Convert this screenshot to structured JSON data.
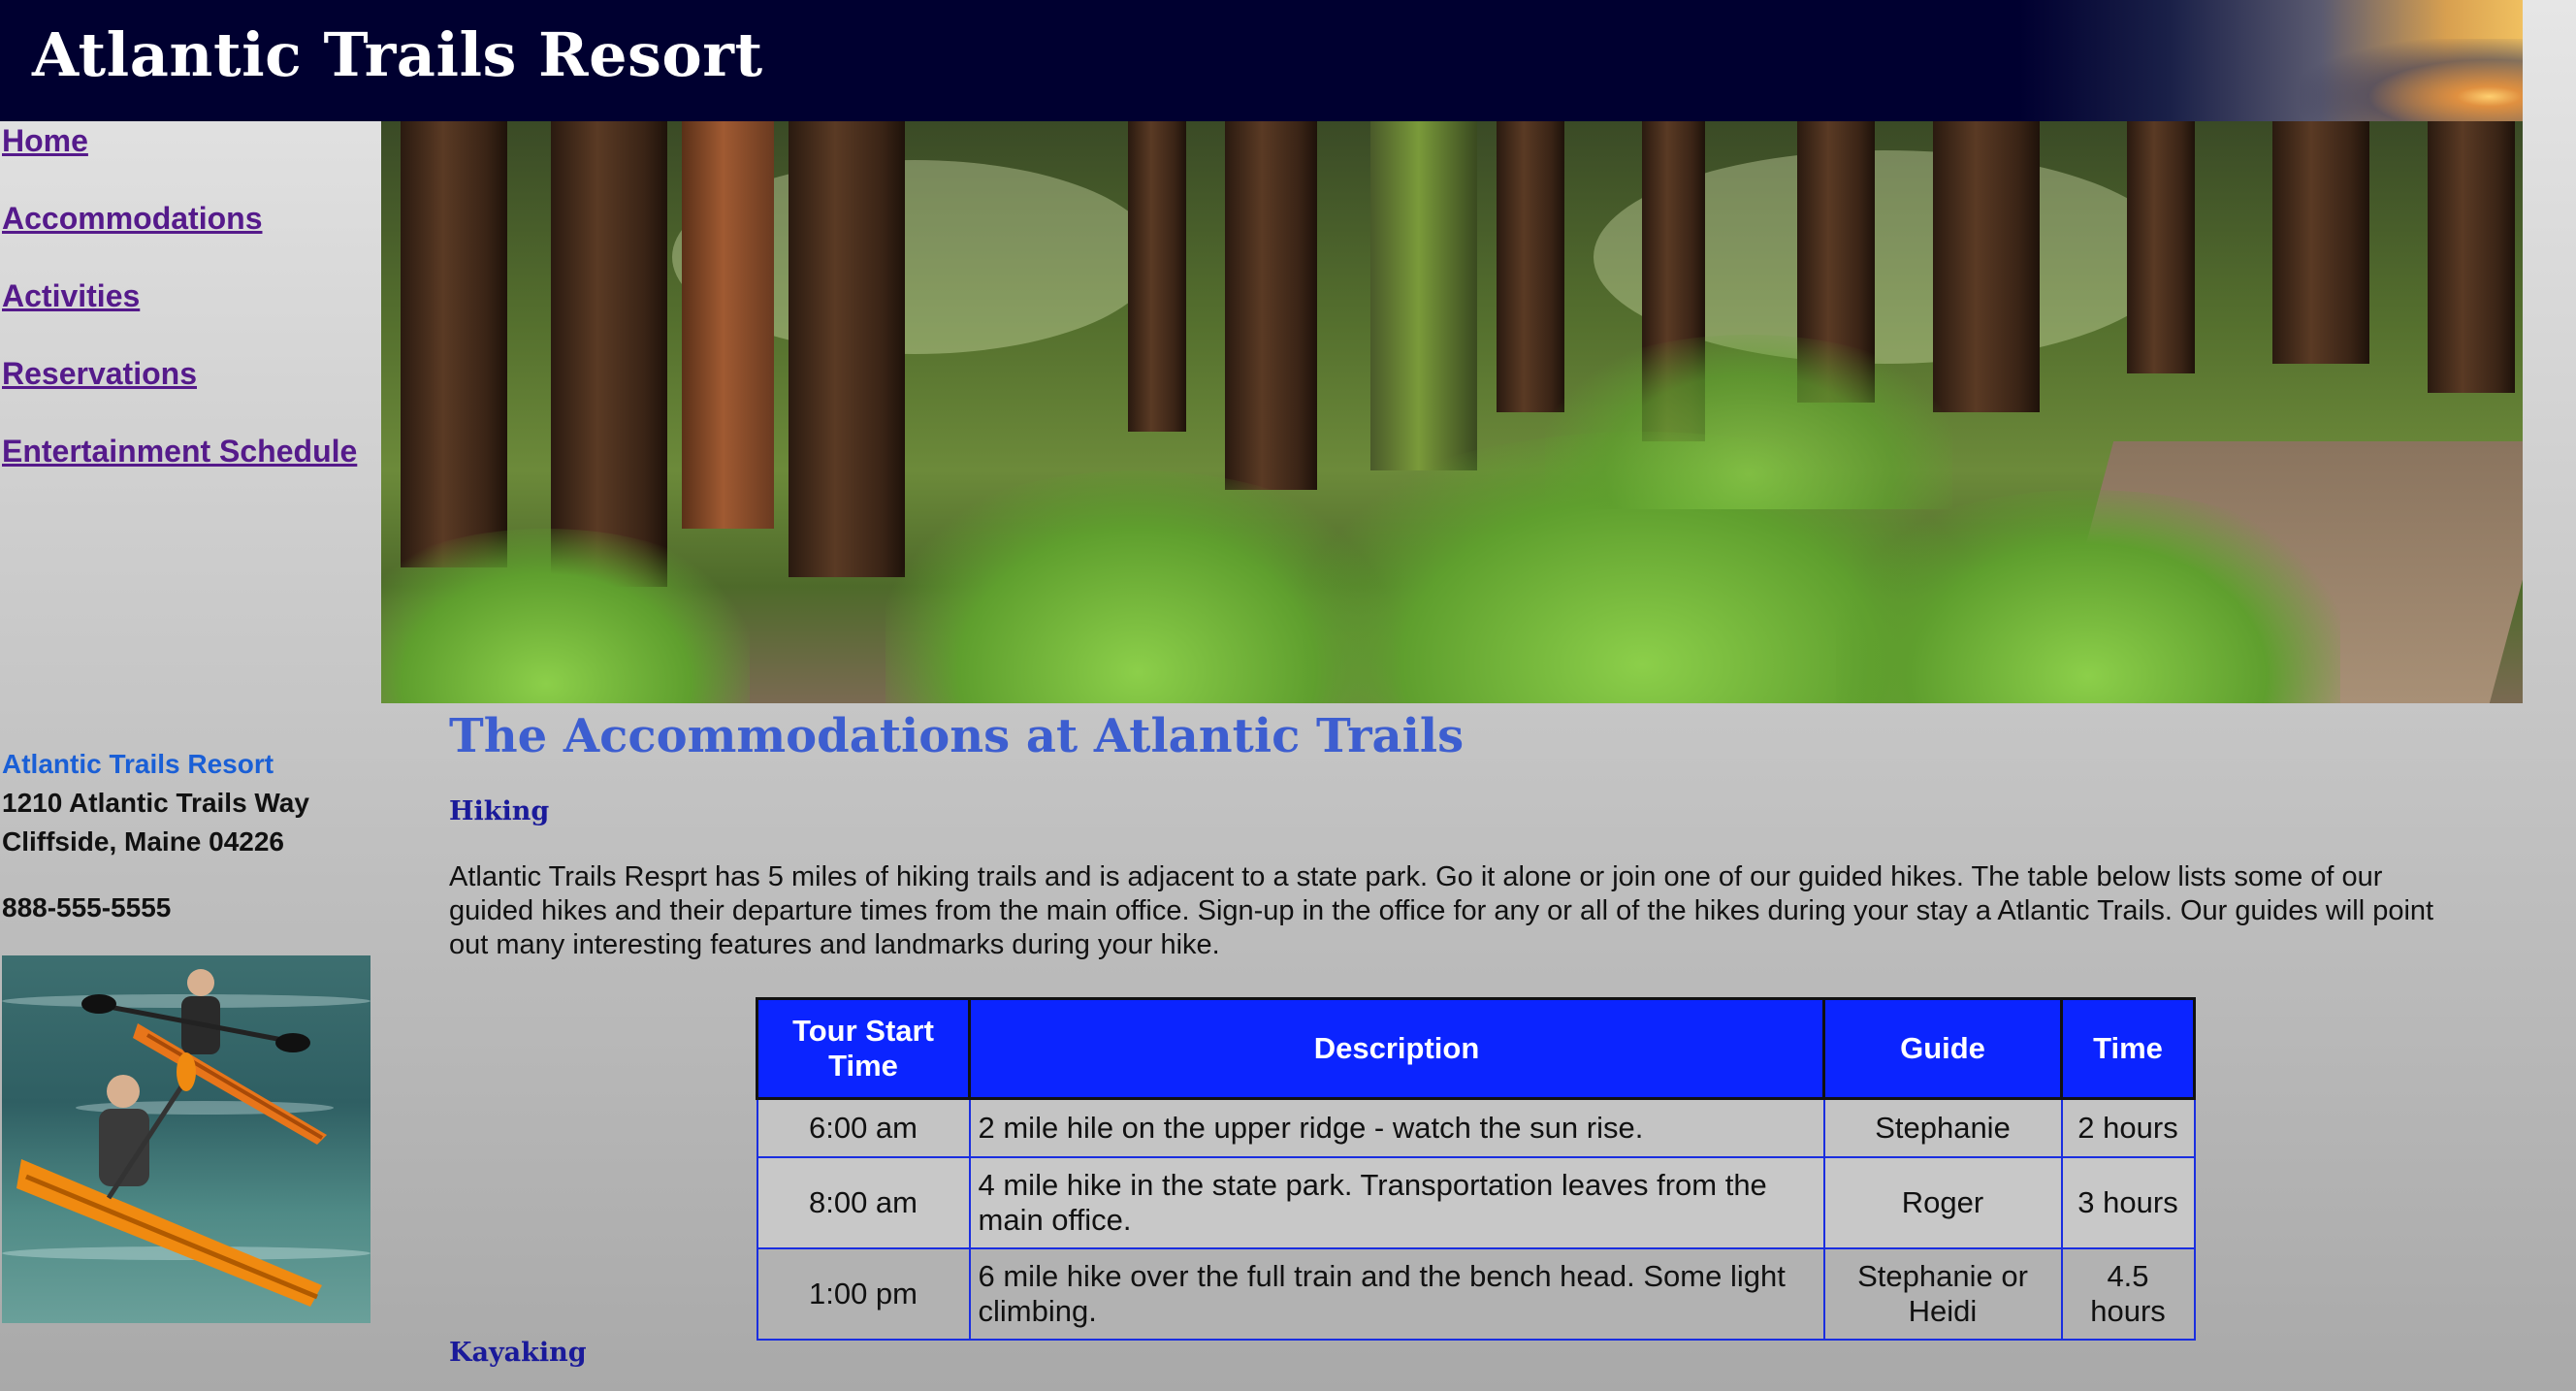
{
  "header": {
    "title": "Atlantic Trails Resort"
  },
  "nav": {
    "items": [
      {
        "label": "Home"
      },
      {
        "label": "Accommodations"
      },
      {
        "label": "Activities"
      },
      {
        "label": "Reservations"
      },
      {
        "label": "Entertainment Schedule"
      }
    ]
  },
  "address": {
    "name": "Atlantic Trails Resort",
    "street": "1210 Atlantic Trails Way",
    "city": "Cliffside, Maine 04226",
    "phone": "888-555-5555"
  },
  "main": {
    "title": "The Accommodations at Atlantic Trails",
    "hiking": {
      "heading": "Hiking",
      "intro": "Atlantic Trails Resprt has 5 miles of hiking trails and is adjacent to a state park. Go it alone or join one of our guided hikes. The table below lists some of our guided hikes and their departure times from the main office. Sign-up in the office for any or all of the hikes during your stay a Atlantic Trails. Our guides will point out many interesting features and landmarks during your hike."
    },
    "table": {
      "headers": [
        "Tour Start Time",
        "Description",
        "Guide",
        "Time"
      ],
      "rows": [
        [
          "6:00 am",
          "2 mile hile on the upper ridge - watch the sun rise.",
          "Stephanie",
          "2 hours"
        ],
        [
          "8:00 am",
          "4 mile hike in the state park. Transportation leaves from the main office.",
          "Roger",
          "3 hours"
        ],
        [
          "1:00 pm",
          "6 mile hike over the full train and the bench head. Some light climbing.",
          "Stephanie or Heidi",
          "4.5 hours"
        ]
      ]
    },
    "kayaking": {
      "heading": "Kayaking"
    }
  },
  "colors": {
    "header_bg": "#000030",
    "link": "#551a8b",
    "title_blue": "#3d5ed0",
    "table_header": "#0b24ff"
  }
}
